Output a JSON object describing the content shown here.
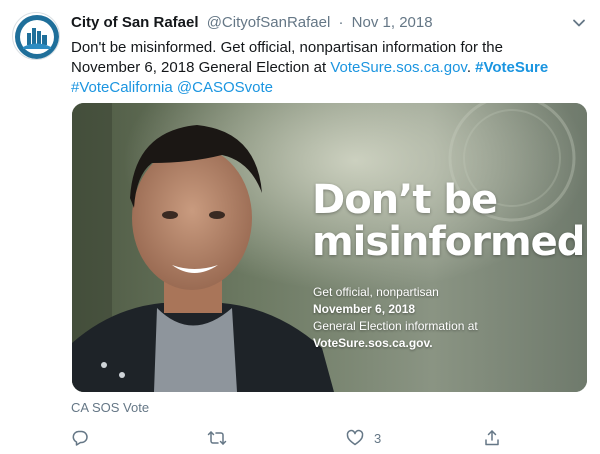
{
  "tweet": {
    "author_name": "City of San Rafael",
    "author_handle": "@CityofSanRafael",
    "separator": "·",
    "date": "Nov 1, 2018",
    "text_line1": "Don't be misinformed. Get official, nonpartisan information for the",
    "text_line2_prefix": "November 6, 2018 General Election at ",
    "text_link": "VoteSure.sos.ca.gov",
    "text_line2_mid": ". ",
    "hashtag1": "#VoteSure",
    "hashtag2": "#VoteCalifornia",
    "mention": "@CASOSvote"
  },
  "media": {
    "headline_line1": "Don’t be",
    "headline_line2": "misinformed.",
    "sub_line1_prefix": "Get official, nonpartisan ",
    "sub_line1_bold": "November 6, 2018",
    "sub_line2": "General Election information at",
    "sub_line3": "VoteSure.sos.ca.gov."
  },
  "card_source": "CA SOS Vote",
  "actions": {
    "like_count": "3"
  },
  "icons": {
    "avatar": "city-logo-icon",
    "menu": "chevron-down-icon",
    "reply": "reply-icon",
    "retweet": "retweet-icon",
    "like": "heart-icon",
    "share": "share-icon"
  },
  "colors": {
    "link": "#1b95e0",
    "secondary_text": "#657786",
    "primary_text": "#14171a"
  }
}
